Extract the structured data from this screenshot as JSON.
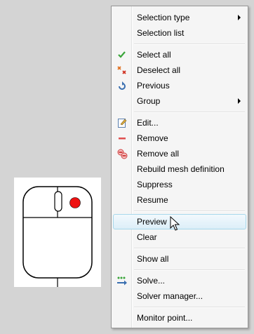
{
  "menu": {
    "items": [
      {
        "label": "Selection type",
        "icon": null,
        "submenu": true
      },
      {
        "label": "Selection list",
        "icon": null,
        "submenu": false
      },
      {
        "label": "Select all",
        "icon": "check-icon",
        "submenu": false
      },
      {
        "label": "Deselect all",
        "icon": "deselect-icon",
        "submenu": false
      },
      {
        "label": "Previous",
        "icon": "previous-icon",
        "submenu": false
      },
      {
        "label": "Group",
        "icon": null,
        "submenu": true
      },
      {
        "label": "Edit...",
        "icon": "edit-icon",
        "submenu": false
      },
      {
        "label": "Remove",
        "icon": "remove-icon",
        "submenu": false
      },
      {
        "label": "Remove all",
        "icon": "remove-all-icon",
        "submenu": false
      },
      {
        "label": "Rebuild mesh definition",
        "icon": null,
        "submenu": false
      },
      {
        "label": "Suppress",
        "icon": null,
        "submenu": false
      },
      {
        "label": "Resume",
        "icon": null,
        "submenu": false
      },
      {
        "label": "Preview",
        "icon": null,
        "submenu": false,
        "highlighted": true
      },
      {
        "label": "Clear",
        "icon": null,
        "submenu": false
      },
      {
        "label": "Show all",
        "icon": null,
        "submenu": false
      },
      {
        "label": "Solve...",
        "icon": "solve-icon",
        "submenu": false
      },
      {
        "label": "Solver manager...",
        "icon": null,
        "submenu": false
      },
      {
        "label": "Monitor point...",
        "icon": null,
        "submenu": false
      }
    ]
  },
  "colors": {
    "highlight_border": "#a8d8eb",
    "mouse_dot": "#ee1111",
    "check_green": "#3aa53a",
    "remove_red": "#e05050"
  }
}
